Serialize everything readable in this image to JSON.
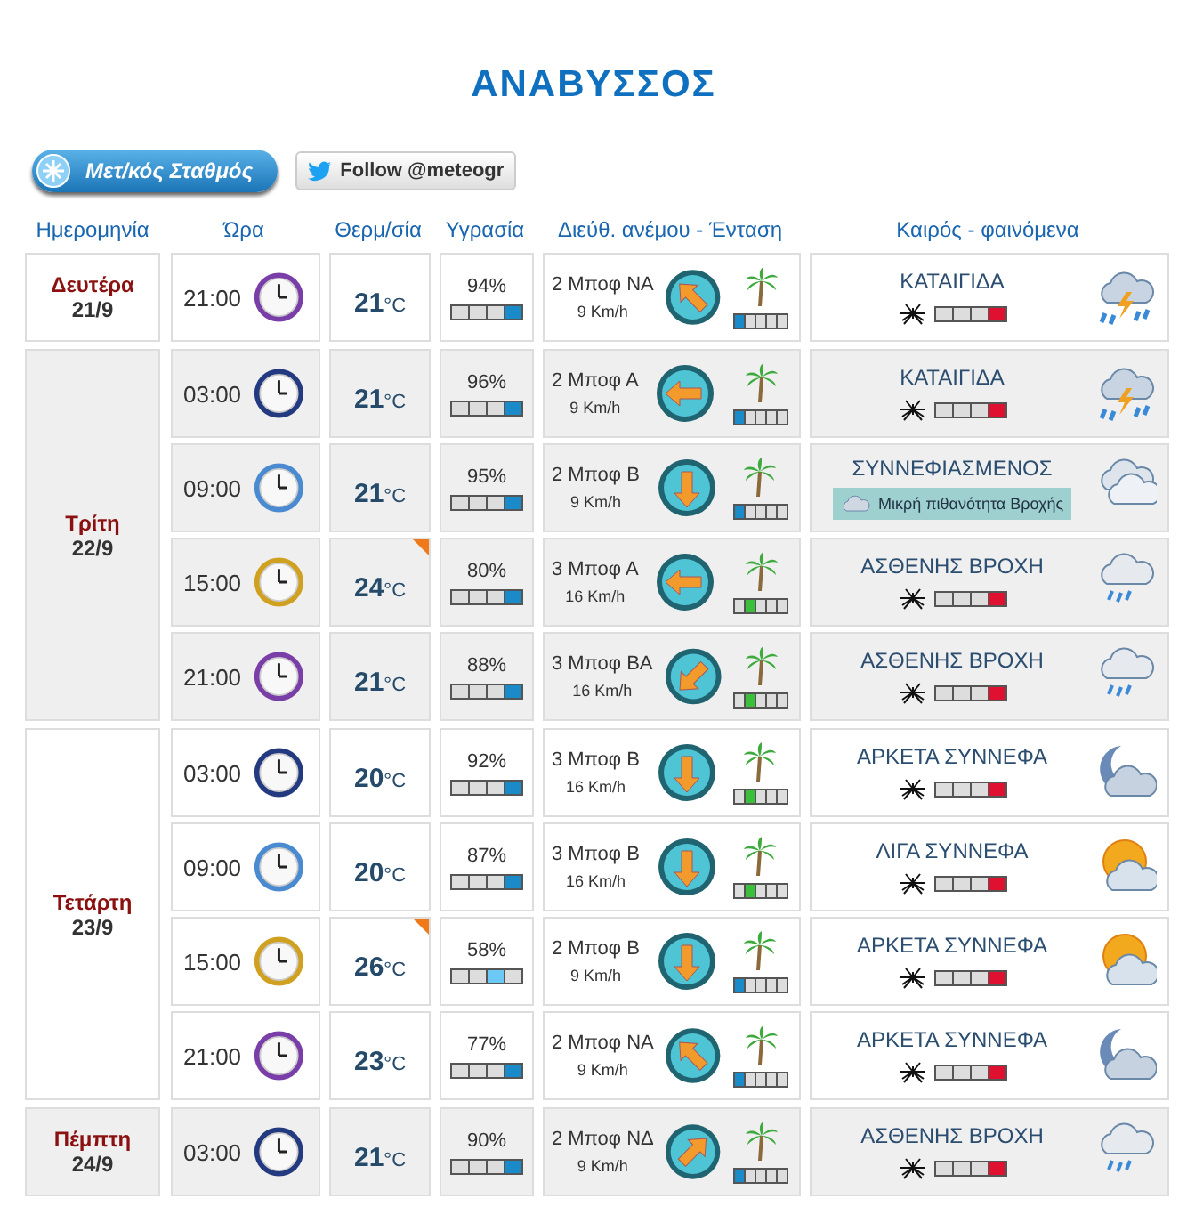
{
  "title": "ΑΝΑΒΥΣΣΟΣ",
  "buttons": {
    "station": "Μετ/κός Σταθμός",
    "follow": "Follow @meteogr"
  },
  "columns": [
    "Ημερομηνία",
    "Ώρα",
    "Θερμ/σία",
    "Υγρασία",
    "Διεύθ. ανέμου - Ένταση",
    "Καιρός - φαινόμενα"
  ],
  "days": [
    {
      "name": "Δευτέρα",
      "date": "21/9",
      "shaded": false,
      "rows": [
        {
          "time": "21:00",
          "clock": {
            "kind": "night"
          },
          "temp": "21",
          "unit": "°C",
          "hot": false,
          "humidity": "94%",
          "humidity_bar": [
            {
              "selected": false
            },
            {
              "selected": false
            },
            {
              "selected": false
            },
            {
              "selected": true
            }
          ],
          "wind": "2 Μποφ ΝΑ",
          "speed": "9 Km/h",
          "wind_arrow": {
            "kind": "up-left"
          },
          "wind_bar": [
            {
              "selected": true
            },
            {
              "selected": false
            },
            {
              "selected": false
            },
            {
              "selected": false
            },
            {
              "selected": false
            }
          ],
          "weather": "ΚΑΤΑΙΓΙΔΑ",
          "weather_icon": {
            "kind": "storm"
          },
          "mosquito_bar": [
            {
              "selected": false
            },
            {
              "selected": false
            },
            {
              "selected": false
            },
            {
              "selected": true
            }
          ]
        }
      ]
    },
    {
      "name": "Τρίτη",
      "date": "22/9",
      "shaded": true,
      "rows": [
        {
          "time": "03:00",
          "clock": {
            "kind": "early"
          },
          "temp": "21",
          "unit": "°C",
          "hot": false,
          "humidity": "96%",
          "humidity_bar": [
            {
              "selected": false
            },
            {
              "selected": false
            },
            {
              "selected": false
            },
            {
              "selected": true
            }
          ],
          "wind": "2 Μποφ Α",
          "speed": "9 Km/h",
          "wind_arrow": {
            "kind": "left"
          },
          "wind_bar": [
            {
              "selected": true
            },
            {
              "selected": false
            },
            {
              "selected": false
            },
            {
              "selected": false
            },
            {
              "selected": false
            }
          ],
          "weather": "ΚΑΤΑΙΓΙΔΑ",
          "weather_icon": {
            "kind": "storm"
          },
          "mosquito_bar": [
            {
              "selected": false
            },
            {
              "selected": false
            },
            {
              "selected": false
            },
            {
              "selected": true
            }
          ]
        },
        {
          "time": "09:00",
          "clock": {
            "kind": "morning"
          },
          "temp": "21",
          "unit": "°C",
          "hot": false,
          "humidity": "95%",
          "humidity_bar": [
            {
              "selected": false
            },
            {
              "selected": false
            },
            {
              "selected": false
            },
            {
              "selected": true
            }
          ],
          "wind": "2 Μποφ Β",
          "speed": "9 Km/h",
          "wind_arrow": {
            "kind": "down"
          },
          "wind_bar": [
            {
              "selected": true
            },
            {
              "selected": false
            },
            {
              "selected": false
            },
            {
              "selected": false
            },
            {
              "selected": false
            }
          ],
          "weather": "ΣΥΝΝΕΦΙΑΣΜΕΝΟΣ",
          "weather_icon": {
            "kind": "cloudy"
          },
          "note": "Μικρή πιθανότητα Βροχής"
        },
        {
          "time": "15:00",
          "clock": {
            "kind": "afternoon"
          },
          "temp": "24",
          "unit": "°C",
          "hot": true,
          "humidity": "80%",
          "humidity_bar": [
            {
              "selected": false
            },
            {
              "selected": false
            },
            {
              "selected": false
            },
            {
              "selected": true
            }
          ],
          "wind": "3 Μποφ Α",
          "speed": "16 Km/h",
          "wind_arrow": {
            "kind": "left"
          },
          "wind_bar": [
            {
              "selected": false
            },
            {
              "selected": true
            },
            {
              "selected": false
            },
            {
              "selected": false
            },
            {
              "selected": false
            }
          ],
          "weather": "ΑΣΘΕΝΗΣ ΒΡΟΧΗ",
          "weather_icon": {
            "kind": "light-rain"
          },
          "mosquito_bar": [
            {
              "selected": false
            },
            {
              "selected": false
            },
            {
              "selected": false
            },
            {
              "selected": true
            }
          ]
        },
        {
          "time": "21:00",
          "clock": {
            "kind": "night"
          },
          "temp": "21",
          "unit": "°C",
          "hot": false,
          "humidity": "88%",
          "humidity_bar": [
            {
              "selected": false
            },
            {
              "selected": false
            },
            {
              "selected": false
            },
            {
              "selected": true
            }
          ],
          "wind": "3 Μποφ ΒΑ",
          "speed": "16 Km/h",
          "wind_arrow": {
            "kind": "down-left"
          },
          "wind_bar": [
            {
              "selected": false
            },
            {
              "selected": true
            },
            {
              "selected": false
            },
            {
              "selected": false
            },
            {
              "selected": false
            }
          ],
          "weather": "ΑΣΘΕΝΗΣ ΒΡΟΧΗ",
          "weather_icon": {
            "kind": "light-rain"
          },
          "mosquito_bar": [
            {
              "selected": false
            },
            {
              "selected": false
            },
            {
              "selected": false
            },
            {
              "selected": true
            }
          ]
        }
      ]
    },
    {
      "name": "Τετάρτη",
      "date": "23/9",
      "shaded": false,
      "rows": [
        {
          "time": "03:00",
          "clock": {
            "kind": "early"
          },
          "temp": "20",
          "unit": "°C",
          "hot": false,
          "humidity": "92%",
          "humidity_bar": [
            {
              "selected": false
            },
            {
              "selected": false
            },
            {
              "selected": false
            },
            {
              "selected": true
            }
          ],
          "wind": "3 Μποφ Β",
          "speed": "16 Km/h",
          "wind_arrow": {
            "kind": "down"
          },
          "wind_bar": [
            {
              "selected": false
            },
            {
              "selected": true
            },
            {
              "selected": false
            },
            {
              "selected": false
            },
            {
              "selected": false
            }
          ],
          "weather": "ΑΡΚΕΤΑ ΣΥΝΝΕΦΑ",
          "weather_icon": {
            "kind": "night-cloudy"
          },
          "mosquito_bar": [
            {
              "selected": false
            },
            {
              "selected": false
            },
            {
              "selected": false
            },
            {
              "selected": true
            }
          ]
        },
        {
          "time": "09:00",
          "clock": {
            "kind": "morning"
          },
          "temp": "20",
          "unit": "°C",
          "hot": false,
          "humidity": "87%",
          "humidity_bar": [
            {
              "selected": false
            },
            {
              "selected": false
            },
            {
              "selected": false
            },
            {
              "selected": true
            }
          ],
          "wind": "3 Μποφ Β",
          "speed": "16 Km/h",
          "wind_arrow": {
            "kind": "down"
          },
          "wind_bar": [
            {
              "selected": false
            },
            {
              "selected": true
            },
            {
              "selected": false
            },
            {
              "selected": false
            },
            {
              "selected": false
            }
          ],
          "weather": "ΛΙΓΑ ΣΥΝΝΕΦΑ",
          "weather_icon": {
            "kind": "sun-cloud"
          },
          "mosquito_bar": [
            {
              "selected": false
            },
            {
              "selected": false
            },
            {
              "selected": false
            },
            {
              "selected": true
            }
          ]
        },
        {
          "time": "15:00",
          "clock": {
            "kind": "afternoon"
          },
          "temp": "26",
          "unit": "°C",
          "hot": true,
          "humidity": "58%",
          "humidity_bar": [
            {
              "selected": false
            },
            {
              "selected": false
            },
            {
              "selected": true
            },
            {
              "selected": false
            }
          ],
          "wind": "2 Μποφ Β",
          "speed": "9 Km/h",
          "wind_arrow": {
            "kind": "down"
          },
          "wind_bar": [
            {
              "selected": true
            },
            {
              "selected": false
            },
            {
              "selected": false
            },
            {
              "selected": false
            },
            {
              "selected": false
            }
          ],
          "weather": "ΑΡΚΕΤΑ ΣΥΝΝΕΦΑ",
          "weather_icon": {
            "kind": "sun-cloud"
          },
          "mosquito_bar": [
            {
              "selected": false
            },
            {
              "selected": false
            },
            {
              "selected": false
            },
            {
              "selected": true
            }
          ]
        },
        {
          "time": "21:00",
          "clock": {
            "kind": "night"
          },
          "temp": "23",
          "unit": "°C",
          "hot": false,
          "humidity": "77%",
          "humidity_bar": [
            {
              "selected": false
            },
            {
              "selected": false
            },
            {
              "selected": false
            },
            {
              "selected": true
            }
          ],
          "wind": "2 Μποφ ΝΑ",
          "speed": "9 Km/h",
          "wind_arrow": {
            "kind": "up-left"
          },
          "wind_bar": [
            {
              "selected": true
            },
            {
              "selected": false
            },
            {
              "selected": false
            },
            {
              "selected": false
            },
            {
              "selected": false
            }
          ],
          "weather": "ΑΡΚΕΤΑ ΣΥΝΝΕΦΑ",
          "weather_icon": {
            "kind": "night-cloudy"
          },
          "mosquito_bar": [
            {
              "selected": false
            },
            {
              "selected": false
            },
            {
              "selected": false
            },
            {
              "selected": true
            }
          ]
        }
      ]
    },
    {
      "name": "Πέμπτη",
      "date": "24/9",
      "shaded": true,
      "rows": [
        {
          "time": "03:00",
          "clock": {
            "kind": "early"
          },
          "temp": "21",
          "unit": "°C",
          "hot": false,
          "humidity": "90%",
          "humidity_bar": [
            {
              "selected": false
            },
            {
              "selected": false
            },
            {
              "selected": false
            },
            {
              "selected": true
            }
          ],
          "wind": "2 Μποφ ΝΔ",
          "speed": "9 Km/h",
          "wind_arrow": {
            "kind": "up-right"
          },
          "wind_bar": [
            {
              "selected": true
            },
            {
              "selected": false
            },
            {
              "selected": false
            },
            {
              "selected": false
            },
            {
              "selected": false
            }
          ],
          "weather": "ΑΣΘΕΝΗΣ ΒΡΟΧΗ",
          "weather_icon": {
            "kind": "light-rain"
          },
          "mosquito_bar": [
            {
              "selected": false
            },
            {
              "selected": false
            },
            {
              "selected": false
            },
            {
              "selected": true
            }
          ]
        }
      ]
    }
  ]
}
